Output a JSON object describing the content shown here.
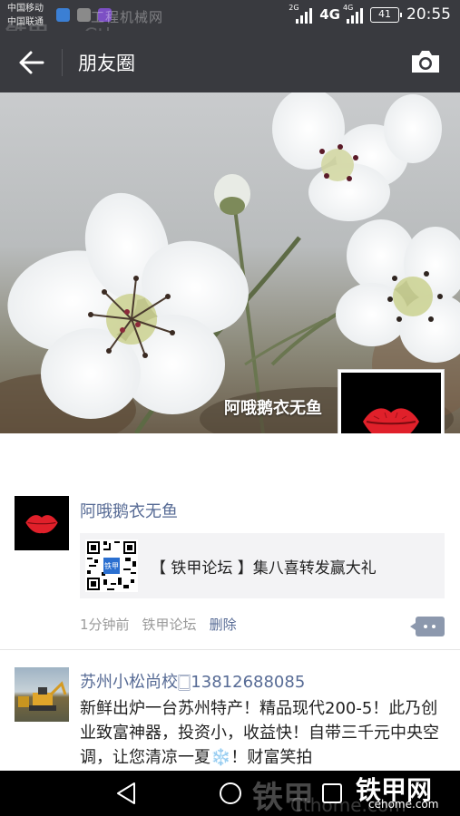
{
  "status_bar": {
    "carrier_1": "中国移动",
    "carrier_2": "中国联通",
    "network_1_label": "2G",
    "network_2_label": "4G",
    "network_2_small": "4G",
    "battery": "41",
    "time": "20:55",
    "watermark_text": "工程机械网",
    "watermark_brand": "铁甲",
    "watermark_domain": "Cthome.com"
  },
  "title_bar": {
    "title": "朋友圈",
    "back_icon": "arrow-left-icon",
    "camera_icon": "camera-icon"
  },
  "profile": {
    "name": "阿哦鹅衣无鱼",
    "avatar_icon": "red-lips-icon"
  },
  "posts": [
    {
      "author": "阿哦鹅衣无鱼",
      "share_title": "【 铁甲论坛 】集八喜转发赢大礼",
      "time": "1分钟前",
      "source": "铁甲论坛",
      "delete_label": "删除"
    },
    {
      "author": "苏州小松尚校🀆13812688085",
      "text": "新鲜出炉一台苏州特产！精品现代200-5！此乃创业致富神器，投资小，收益快！自带三千元中央空调，让您清凉一夏❄️！财富笑拍"
    }
  ],
  "nav_bar": {
    "back_icon": "triangle-back-icon",
    "home_icon": "circle-home-icon",
    "recent_icon": "square-recent-icon"
  },
  "bottom_watermark": {
    "brand_cn": "铁甲网",
    "brand_domain": "cehome.com",
    "faded_text": "铁甲",
    "faded_domain": "Cthome.com"
  },
  "colors": {
    "bar_bg": "#393a3f",
    "link_blue": "#576b95",
    "meta_gray": "#9b9b9b",
    "card_bg": "#f3f3f5"
  }
}
